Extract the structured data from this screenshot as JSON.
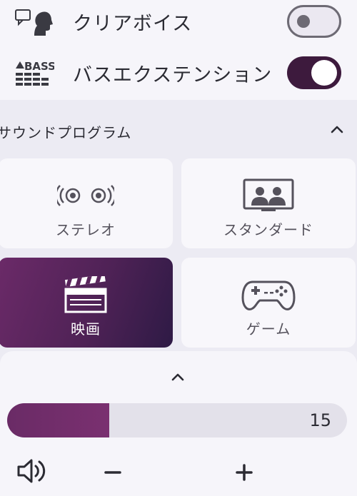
{
  "settings": {
    "clear_voice": {
      "label": "クリアボイス",
      "enabled": false,
      "icon": "clear-voice-icon"
    },
    "bass_extension": {
      "label": "バスエクステンション",
      "enabled": true,
      "icon": "bass-icon",
      "icon_text": "BASS"
    }
  },
  "sound_program": {
    "title": "サウンドプログラム",
    "expanded": true,
    "items": [
      {
        "label": "ステレオ",
        "icon": "stereo-speakers-icon",
        "selected": false
      },
      {
        "label": "スタンダード",
        "icon": "tv-viewers-icon",
        "selected": false
      },
      {
        "label": "映画",
        "icon": "clapperboard-icon",
        "selected": true
      },
      {
        "label": "ゲーム",
        "icon": "gamepad-icon",
        "selected": false
      }
    ]
  },
  "volume": {
    "value": "15",
    "level_fraction": 0.3,
    "accent_color": "#6a2b66"
  },
  "colors": {
    "toggle_on": "#3d1a3d",
    "selected_card_gradient_start": "#6b2a68",
    "selected_card_gradient_end": "#2e1a45"
  }
}
